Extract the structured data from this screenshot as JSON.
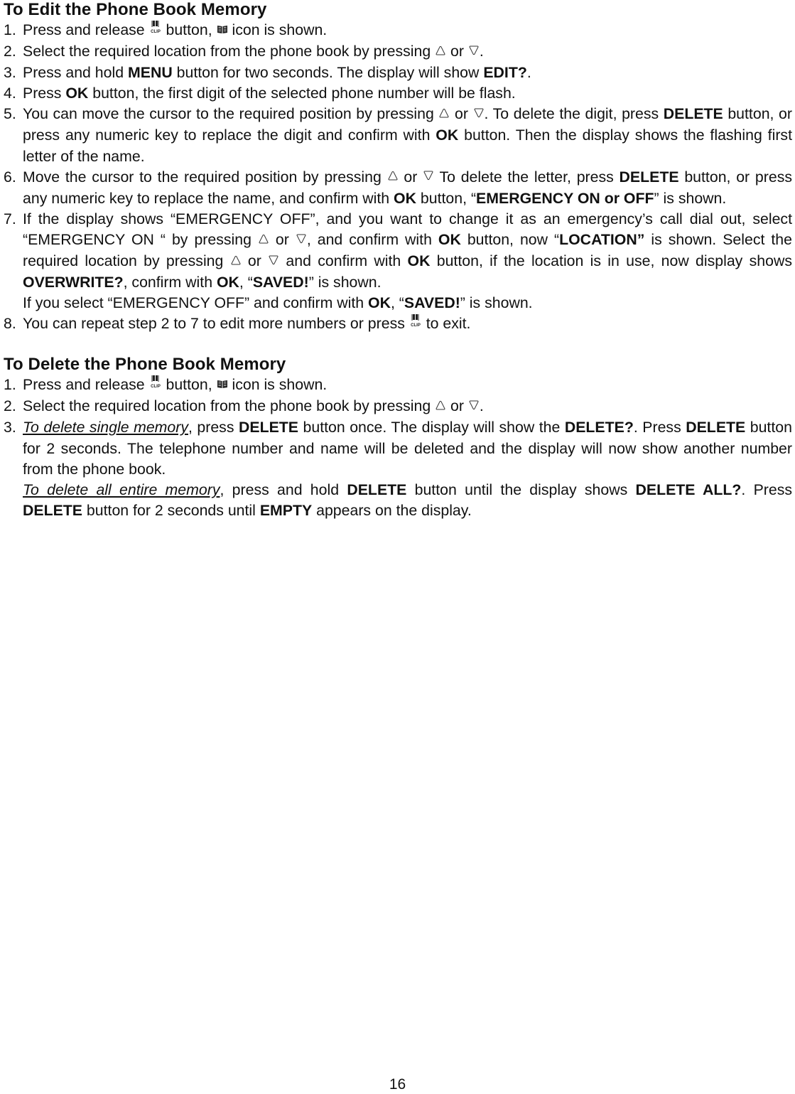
{
  "page_number": "16",
  "icons": {
    "clip_button": "phonebook-clip-button-icon",
    "phonebook": "phonebook-icon",
    "up": "up-arrow-key-icon",
    "down": "down-arrow-key-icon"
  },
  "edit_section": {
    "title": "To Edit the Phone Book Memory",
    "steps": [
      {
        "num": "1.",
        "segments": [
          {
            "t": "Press and release "
          },
          {
            "icon": "clip"
          },
          {
            "t": " button, "
          },
          {
            "icon": "book"
          },
          {
            "t": " icon is shown."
          }
        ]
      },
      {
        "num": "2.",
        "segments": [
          {
            "t": "Select the required location from the phone book by pressing "
          },
          {
            "icon": "up"
          },
          {
            "t": " or "
          },
          {
            "icon": "down"
          },
          {
            "t": "."
          }
        ]
      },
      {
        "num": "3.",
        "segments": [
          {
            "t": "Press and hold "
          },
          {
            "b": "MENU"
          },
          {
            "t": " button for two seconds. The display will show "
          },
          {
            "b": "EDIT?"
          },
          {
            "t": "."
          }
        ]
      },
      {
        "num": "4.",
        "segments": [
          {
            "t": "Press "
          },
          {
            "b": "OK"
          },
          {
            "t": " button, the first digit of the selected phone number will be flash."
          }
        ]
      },
      {
        "num": "5.",
        "segments": [
          {
            "t": "You can move the cursor to the required position by pressing "
          },
          {
            "icon": "up"
          },
          {
            "t": " or "
          },
          {
            "icon": "down"
          },
          {
            "t": ". To delete the digit, press "
          },
          {
            "b": "DELETE"
          },
          {
            "t": " button, or press any numeric key to replace the digit and confirm with "
          },
          {
            "b": "OK"
          },
          {
            "t": " button. Then the display shows the flashing first letter of the name."
          }
        ]
      },
      {
        "num": "6.",
        "segments": [
          {
            "t": "Move the cursor to the required position by pressing "
          },
          {
            "icon": "up"
          },
          {
            "t": " or "
          },
          {
            "icon": "down"
          },
          {
            "t": " To delete the letter, press "
          },
          {
            "b": "DELETE"
          },
          {
            "t": " button, or press any numeric key to replace the name, and confirm with "
          },
          {
            "b": "OK"
          },
          {
            "t": " button, “"
          },
          {
            "b": "EMERGENCY ON or OFF"
          },
          {
            "t": "” is shown."
          }
        ]
      },
      {
        "num": "7.",
        "segments": [
          {
            "t": "If the display shows “EMERGENCY OFF”, and you want to change it as an emergency’s call dial out, select “EMERGENCY ON “ by pressing "
          },
          {
            "icon": "up"
          },
          {
            "t": " or "
          },
          {
            "icon": "down"
          },
          {
            "t": ", and confirm with "
          },
          {
            "b": "OK"
          },
          {
            "t": " button, now “"
          },
          {
            "b": "LOCATION”"
          },
          {
            "t": " is shown. Select the required location by pressing "
          },
          {
            "icon": "up"
          },
          {
            "t": " or "
          },
          {
            "icon": "down"
          },
          {
            "t": " and confirm with "
          },
          {
            "b": "OK"
          },
          {
            "t": " button, if the location is in use, now display shows "
          },
          {
            "b": "OVERWRITE?"
          },
          {
            "t": ", confirm with "
          },
          {
            "b": "OK"
          },
          {
            "t": ", “"
          },
          {
            "b": "SAVED!"
          },
          {
            "t": "” is shown."
          }
        ],
        "extra": [
          {
            "t": "If you select “EMERGENCY OFF” and confirm with "
          },
          {
            "b": "OK"
          },
          {
            "t": ", “"
          },
          {
            "b": "SAVED!"
          },
          {
            "t": "” is shown."
          }
        ]
      },
      {
        "num": "8.",
        "segments": [
          {
            "t": "You can repeat step 2 to 7 to edit more numbers or press "
          },
          {
            "icon": "clip"
          },
          {
            "t": " to exit."
          }
        ]
      }
    ]
  },
  "delete_section": {
    "title": "To Delete the Phone Book Memory",
    "steps": [
      {
        "num": "1.",
        "segments": [
          {
            "t": "Press and release "
          },
          {
            "icon": "clip"
          },
          {
            "t": " button, "
          },
          {
            "icon": "book"
          },
          {
            "t": " icon is shown."
          }
        ]
      },
      {
        "num": "2.",
        "segments": [
          {
            "t": "Select the required location from the phone book by pressing "
          },
          {
            "icon": "up"
          },
          {
            "t": " or "
          },
          {
            "icon": "down"
          },
          {
            "t": "."
          }
        ]
      },
      {
        "num": "3.",
        "segments": [
          {
            "u": "To delete single memory"
          },
          {
            "t": ", press "
          },
          {
            "b": "DELETE"
          },
          {
            "t": " button once. The display will show the "
          },
          {
            "b": "DELETE?"
          },
          {
            "t": ". Press "
          },
          {
            "b": "DELETE"
          },
          {
            "t": " button for 2 seconds. The telephone number and name will be deleted and the display will now show another number from the phone book."
          }
        ],
        "extra": [
          {
            "u": "To delete all entire memory"
          },
          {
            "t": ", press and hold "
          },
          {
            "b": "DELETE"
          },
          {
            "t": " button until the display shows "
          },
          {
            "b": "DELETE ALL?"
          },
          {
            "t": ". Press "
          },
          {
            "b": "DELETE"
          },
          {
            "t": " button for 2 seconds until "
          },
          {
            "b": "EMPTY"
          },
          {
            "t": " appears on the display."
          }
        ]
      }
    ]
  }
}
